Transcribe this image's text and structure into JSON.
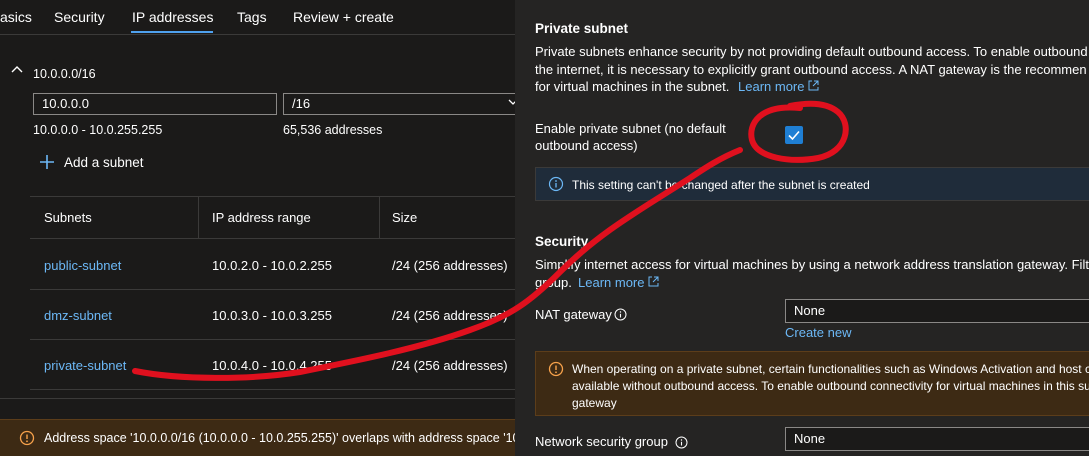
{
  "tabs": [
    {
      "label": "asics"
    },
    {
      "label": "Security"
    },
    {
      "label": "IP addresses"
    },
    {
      "label": "Tags"
    },
    {
      "label": "Review + create"
    }
  ],
  "address_space": {
    "cidr": "10.0.0.0/16",
    "address_value": "10.0.0.0",
    "prefix_value": "/16",
    "range": "10.0.0.0 - 10.0.255.255",
    "count": "65,536 addresses",
    "add_subnet_label": "Add a subnet"
  },
  "subnets_table": {
    "headers": [
      "Subnets",
      "IP address range",
      "Size"
    ],
    "rows": [
      {
        "name": "public-subnet",
        "range": "10.0.2.0 - 10.0.2.255",
        "size": "/24 (256 addresses)"
      },
      {
        "name": "dmz-subnet",
        "range": "10.0.3.0 - 10.0.3.255",
        "size": "/24 (256 addresses)"
      },
      {
        "name": "private-subnet",
        "range": "10.0.4.0 - 10.0.4.255",
        "size": "/24 (256 addresses)"
      }
    ]
  },
  "bottom_warning": "Address space '10.0.0.0/16 (10.0.0.0 - 10.0.255.255)' overlaps with address space '10.0.0.0/",
  "private_subnet": {
    "heading": "Private subnet",
    "desc_line1": "Private subnets enhance security by not providing default outbound access. To enable outbound",
    "desc_line2": "the internet, it is necessary to explicitly grant outbound access. A NAT gateway is the recommen",
    "desc_line3": "for virtual machines in the subnet.",
    "learn_more": "Learn more",
    "enable_label_line1": "Enable private subnet (no default",
    "enable_label_line2": "outbound access)",
    "enabled": true,
    "info_text": "This setting can't be changed after the subnet is created"
  },
  "security": {
    "heading": "Security",
    "desc_line1": "Simplify internet access for virtual machines by using a network address translation gateway. Filte",
    "desc_line2": "group.",
    "learn_more": "Learn more",
    "nat_label": "NAT gateway",
    "nat_value": "None",
    "create_new": "Create new",
    "warn_line1": "When operating on a private subnet, certain functionalities such as Windows Activation and host c",
    "warn_line2": "available without outbound access. To enable outbound connectivity for virtual machines in this su",
    "warn_line3": "gateway",
    "nsg_label": "Network security group",
    "nsg_value": "None"
  },
  "colors": {
    "accent": "#4fa1ee",
    "link": "#6cb8f6",
    "annotation": "#e0101e",
    "warning": "#f7a24b"
  }
}
